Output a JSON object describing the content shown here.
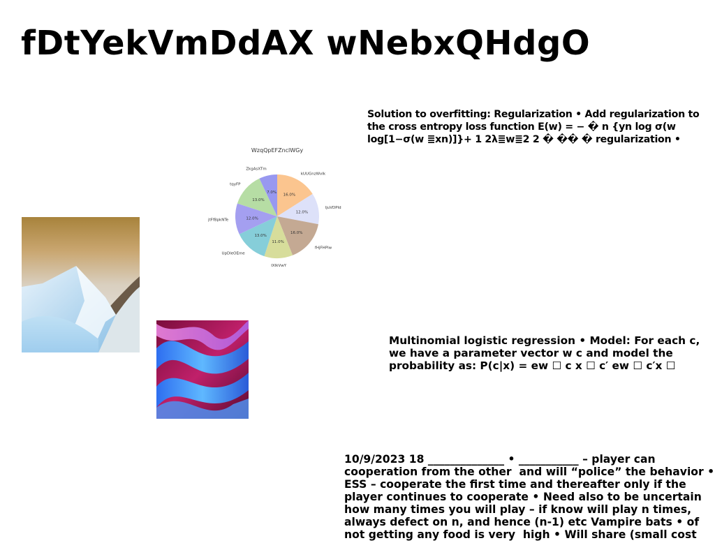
{
  "title": "fDtYekVmDdAX wNebxQHdgO",
  "paragraphs": [
    "Solution to overfitting: Regularization • Add regularization to the cross entropy loss function E(w) = − � n {yn log σ(w log[1−σ(w ≣xn)]}+ 1 2λ≣w≣2 2 � �� � regularization •",
    "Multinomial logistic regression • Model: For each c, we have a parameter vector w c and model the probability as: P(c|x) = ew ☐ c x ☐ c′ ew ☐ c′x ☐",
    "10/9/2023 18 ______________ • ___________ – player can cooperation from the other  and will “police” the behavior • ESS – cooperate the first time and thereafter only if the player continues to cooperate • Need also to be uncertain how many times you will play – if know will play n times, always defect on n, and hence (n-1) etc Vampire bats • of not getting any food is very  high • Will share (small cost"
  ],
  "images": {
    "mountain": "snowy mountain ridge photo",
    "waves": "abstract blue and pink waves"
  },
  "chart_data": {
    "type": "pie",
    "title": "WzqQpEFZnclWGy",
    "labels": [
      "kUUGnzWvIk",
      "ljuVDPld",
      "fHjFHPlw",
      "IXIkVwY",
      "UpDleOEme",
      "jtFfBpkNTe",
      "tqyFP",
      "ZkgAsXTm"
    ],
    "values": [
      16.0,
      12.0,
      16.0,
      11.0,
      13.0,
      12.0,
      13.0,
      7.0
    ],
    "value_labels": [
      "16.0%",
      "12.0%",
      "16.0%",
      "11.0%",
      "13.0%",
      "12.0%",
      "13.0%",
      "7.0%"
    ],
    "colors": [
      "#fbc58f",
      "#dde1f9",
      "#c4a993",
      "#d7dd9b",
      "#86ced9",
      "#a49ff0",
      "#b6dda4",
      "#9898f0"
    ],
    "start": "top",
    "direction": "clockwise"
  }
}
